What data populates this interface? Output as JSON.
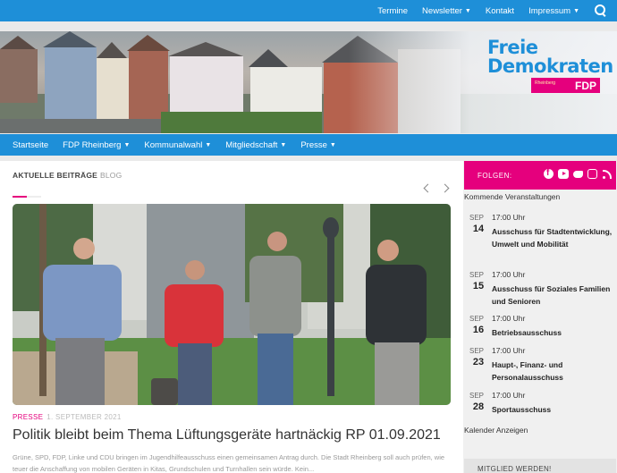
{
  "topnav": {
    "items": [
      {
        "label": "Termine",
        "caret": false
      },
      {
        "label": "Newsletter",
        "caret": true
      },
      {
        "label": "Kontakt",
        "caret": false
      },
      {
        "label": "Impressum",
        "caret": true
      }
    ],
    "search_icon": "search-icon"
  },
  "header": {
    "logo_line1": "Freie",
    "logo_line2": "Demokraten",
    "logo_small": "Rheinberg",
    "logo_tag": "FDP"
  },
  "mainnav": {
    "items": [
      {
        "label": "Startseite",
        "caret": false
      },
      {
        "label": "FDP Rheinberg",
        "caret": true
      },
      {
        "label": "Kommunalwahl",
        "caret": true
      },
      {
        "label": "Mitgliedschaft",
        "caret": true
      },
      {
        "label": "Presse",
        "caret": true
      }
    ]
  },
  "content": {
    "section_title": "AKTUELLE BEITRÄGE",
    "section_sub": "BLOG",
    "post": {
      "category": "PRESSE",
      "date": "1. SEPTEMBER 2021",
      "title": "Politik bleibt beim Thema Lüftungsgeräte hartnäckig RP 01.09.2021",
      "excerpt": "Grüne, SPD, FDP, Linke und CDU bringen im Jugendhilfeausschuss einen gemeinsamen Antrag durch. Die Stadt Rheinberg soll auch prüfen, wie teuer die Anschaffung von mobilen Geräten in Kitas, Grundschulen und Turnhallen sein würde. Kein..."
    }
  },
  "sidebar": {
    "follow_label": "FOLGEN:",
    "social_icons": [
      "facebook-icon",
      "youtube-icon",
      "twitter-icon",
      "instagram-icon",
      "rss-icon"
    ],
    "events_heading": "Kommende Veranstaltungen",
    "events": [
      {
        "month": "SEP",
        "day": "14",
        "time": "17:00 Uhr",
        "name": "Ausschuss für Stadtentwicklung, Umwelt und Mobilität"
      },
      {
        "month": "SEP",
        "day": "15",
        "time": "17:00 Uhr",
        "name": "Ausschuss für Soziales Familien und Senioren"
      },
      {
        "month": "SEP",
        "day": "16",
        "time": "17:00 Uhr",
        "name": "Betriebsausschuss"
      },
      {
        "month": "SEP",
        "day": "23",
        "time": "17:00 Uhr",
        "name": "Haupt-, Finanz- und Personalausschuss"
      },
      {
        "month": "SEP",
        "day": "28",
        "time": "17:00 Uhr",
        "name": "Sportausschuss"
      }
    ],
    "calendar_link": "Kalender Anzeigen",
    "member_box": "MITGLIED WERDEN!"
  },
  "colors": {
    "blue": "#1e8fd8",
    "magenta": "#e5007d"
  }
}
